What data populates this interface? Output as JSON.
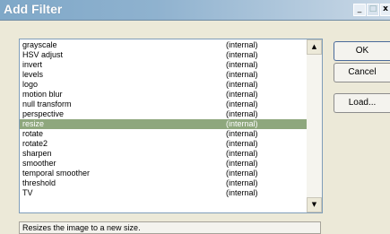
{
  "window": {
    "title": "Add Filter",
    "minimize_glyph": "_",
    "maximize_glyph": "□",
    "close_glyph": "x"
  },
  "filters": [
    {
      "name": "grayscale",
      "type": "(internal)"
    },
    {
      "name": "HSV adjust",
      "type": "(internal)"
    },
    {
      "name": "invert",
      "type": "(internal)"
    },
    {
      "name": "levels",
      "type": "(internal)"
    },
    {
      "name": "logo",
      "type": "(internal)"
    },
    {
      "name": "motion blur",
      "type": "(internal)"
    },
    {
      "name": "null transform",
      "type": "(internal)"
    },
    {
      "name": "perspective",
      "type": "(internal)"
    },
    {
      "name": "resize",
      "type": "(internal)"
    },
    {
      "name": "rotate",
      "type": "(internal)"
    },
    {
      "name": "rotate2",
      "type": "(internal)"
    },
    {
      "name": "sharpen",
      "type": "(internal)"
    },
    {
      "name": "smoother",
      "type": "(internal)"
    },
    {
      "name": "temporal smoother",
      "type": "(internal)"
    },
    {
      "name": "threshold",
      "type": "(internal)"
    },
    {
      "name": "TV",
      "type": "(internal)"
    }
  ],
  "selected_filter": "resize",
  "scrollbar": {
    "up_glyph": "▲",
    "down_glyph": "▼"
  },
  "buttons": {
    "ok": "OK",
    "cancel": "Cancel",
    "load": "Load..."
  },
  "description": "Resizes the image to a new size.",
  "colors": {
    "selection": "#8ea77d",
    "title_gradient_start": "#7fa8c8"
  }
}
